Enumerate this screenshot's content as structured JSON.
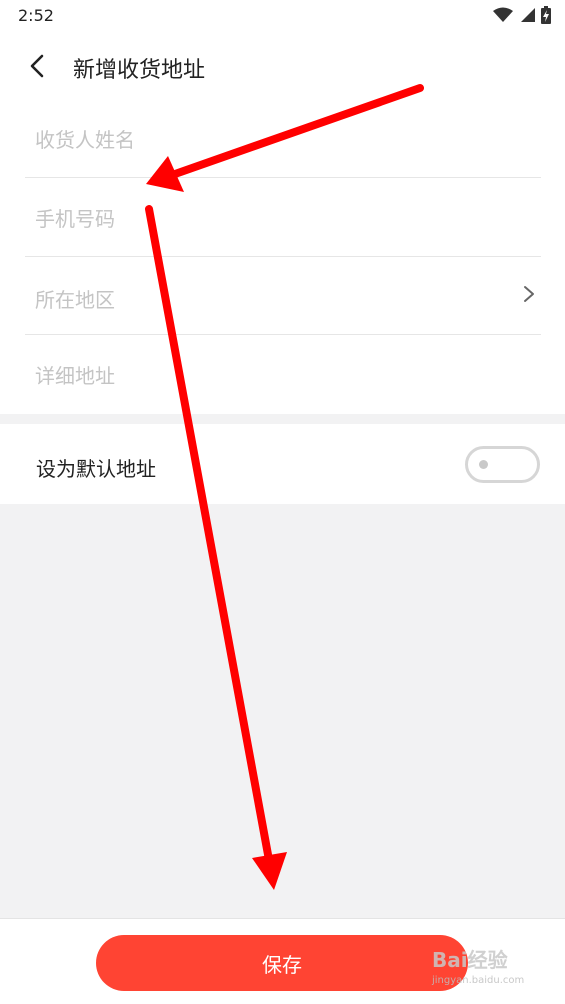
{
  "status_bar": {
    "time": "2:52",
    "icons": [
      "wifi-icon",
      "signal-icon",
      "battery-icon"
    ]
  },
  "header": {
    "back_icon": "chevron-left-icon",
    "title": "新增收货地址"
  },
  "form": {
    "name": {
      "value": "",
      "placeholder": "收货人姓名"
    },
    "phone": {
      "value": "",
      "placeholder": "手机号码"
    },
    "region": {
      "placeholder": "所在地区",
      "icon": "chevron-right-icon"
    },
    "detail": {
      "value": "",
      "placeholder": "详细地址"
    }
  },
  "default_address": {
    "label": "设为默认地址",
    "enabled": false
  },
  "footer": {
    "save_label": "保存"
  },
  "watermark": {
    "text": "Bai经验",
    "sub": "jingyan.baidu.com"
  },
  "colors": {
    "accent": "#ff4433",
    "annotation": "#ff0000",
    "background": "#f2f2f3",
    "placeholder": "#c4c4c4"
  }
}
